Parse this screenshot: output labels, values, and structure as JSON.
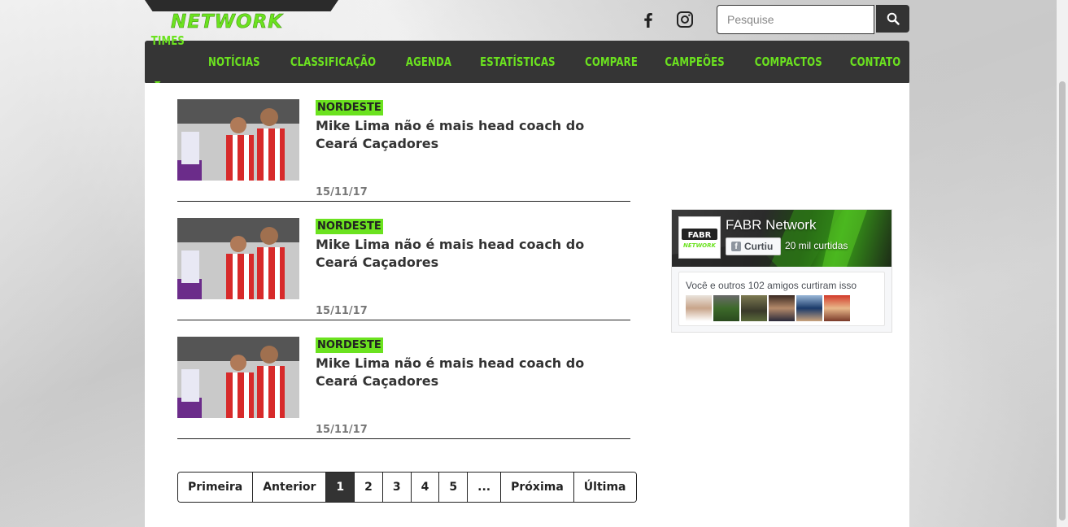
{
  "header": {
    "logo_text": "NETWORK",
    "search": {
      "placeholder": "Pesquise"
    },
    "social": [
      "facebook-icon",
      "instagram-icon"
    ]
  },
  "nav": {
    "items": [
      {
        "label": "TIMES",
        "dropdown": true
      },
      {
        "label": "NOTÍCIAS"
      },
      {
        "label": "CLASSIFICAÇÃO"
      },
      {
        "label": "AGENDA"
      },
      {
        "label": "ESTATÍSTICAS"
      },
      {
        "label": "COMPARE"
      },
      {
        "label": "CAMPEÕES"
      },
      {
        "label": "COMPACTOS"
      },
      {
        "label": "CONTATO"
      }
    ]
  },
  "posts": [
    {
      "tag": "NORDESTE",
      "title": "Mike Lima não é mais head coach do Ceará Caçadores",
      "date": "15/11/17"
    },
    {
      "tag": "NORDESTE",
      "title": "Mike Lima não é mais head coach do Ceará Caçadores",
      "date": "15/11/17"
    },
    {
      "tag": "NORDESTE",
      "title": "Mike Lima não é mais head coach do Ceará Caçadores",
      "date": "15/11/17"
    }
  ],
  "pagination": {
    "first": "Primeira",
    "prev": "Anterior",
    "pages": [
      "1",
      "2",
      "3",
      "4",
      "5",
      "..."
    ],
    "active_page": "1",
    "next": "Próxima",
    "last": "Última"
  },
  "facebook": {
    "page_name": "FABR Network",
    "like_label": "Curtiu",
    "likes_count": "20 mil curtidas",
    "friends_text": "Você e outros 102 amigos curtiram isso"
  },
  "colors": {
    "accent": "#6be21f",
    "nav_bg": "#353535",
    "text": "#333333"
  }
}
